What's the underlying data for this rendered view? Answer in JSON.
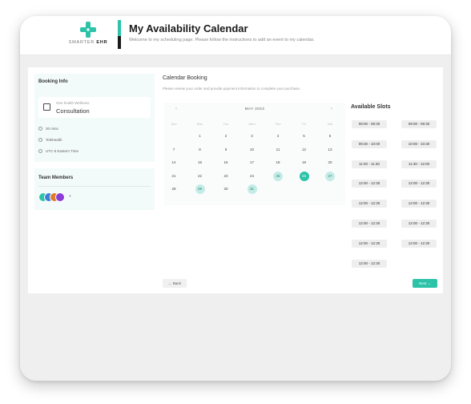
{
  "header": {
    "logo_text_light": "SMARTER",
    "logo_text_bold": "EHR",
    "title": "My Availability Calendar",
    "subtitle": "Welcome to my scheduling page. Please follow the instructions to add an event to my calendar.",
    "accent_color": "#2cc3a8"
  },
  "booking_info": {
    "label": "Booking Info",
    "appointment_caption": "One health Wellness",
    "appointment_name": "Consultation",
    "details": [
      "30 mins",
      "Telehealth",
      "UTC-5 Eastern Time"
    ]
  },
  "team": {
    "label": "Team Members",
    "avatar_colors": [
      "#2cc3a8",
      "#3b7dd8",
      "#e07a2c",
      "#8a3bd8"
    ],
    "more": "+"
  },
  "calendar": {
    "title": "Calendar Booking",
    "subtitle": "Please review your order and provide payment information to complete your purchase.",
    "prev": "‹",
    "next": "›",
    "month": "MAY 2023",
    "weekdays": [
      "Sun",
      "Mon",
      "Tue",
      "Wed",
      "Thu",
      "Fri",
      "Sat"
    ],
    "weeks": [
      [
        null,
        "1",
        "2",
        "3",
        "4",
        "5",
        "6"
      ],
      [
        "7",
        "8",
        "9",
        "10",
        "11",
        "12",
        "13"
      ],
      [
        "14",
        "15",
        "16",
        "17",
        "18",
        "19",
        "20"
      ],
      [
        "21",
        "22",
        "23",
        "24",
        "25",
        "26",
        "27"
      ],
      [
        "28",
        "29",
        "30",
        "31",
        null,
        null,
        null
      ]
    ],
    "available_days": [
      "25",
      "27",
      "29",
      "31"
    ],
    "selected_day": "26"
  },
  "slots": {
    "label": "Available Slots",
    "left": [
      "09:00 - 09:30",
      "09:30 - 10:00",
      "11:00 - 11:30",
      "12:00 - 12:30",
      "12:00 - 12:30",
      "12:00 - 12:30",
      "12:00 - 12:30",
      "12:00 - 12:30"
    ],
    "right": [
      "09:00 - 09:30",
      "10:00 - 10:30",
      "11:30 - 12:00",
      "12:00 - 12:30",
      "12:00 - 12:30",
      "12:00 - 12:30",
      "12:00 - 12:30"
    ]
  },
  "actions": {
    "back": "← Back",
    "next": "Next →"
  }
}
